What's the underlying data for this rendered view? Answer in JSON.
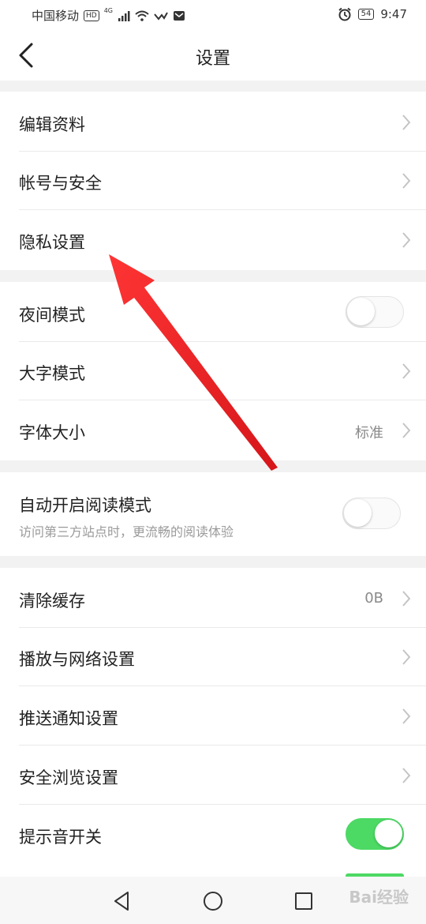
{
  "status_bar": {
    "carrier": "中国移动",
    "hd": "HD",
    "network": "4G",
    "battery": "54",
    "time": "9:47"
  },
  "header": {
    "title": "设置"
  },
  "groups": {
    "account": [
      {
        "label": "编辑资料"
      },
      {
        "label": "帐号与安全"
      },
      {
        "label": "隐私设置"
      }
    ],
    "display": [
      {
        "label": "夜间模式",
        "toggle": false
      },
      {
        "label": "大字模式"
      },
      {
        "label": "字体大小",
        "value": "标准"
      }
    ],
    "reading": {
      "label": "自动开启阅读模式",
      "description": "访问第三方站点时，更流畅的阅读体验",
      "toggle": false
    },
    "other": [
      {
        "label": "清除缓存",
        "value": "0B"
      },
      {
        "label": "播放与网络设置"
      },
      {
        "label": "推送通知设置"
      },
      {
        "label": "安全浏览设置"
      },
      {
        "label": "提示音开关",
        "toggle": true
      }
    ]
  },
  "colors": {
    "toggle_on": "#4cd964",
    "annotation_arrow": "#e8161a"
  },
  "icons": [
    "back-icon",
    "chevron-right-icon",
    "nav-back-icon",
    "nav-home-icon",
    "nav-recent-icon",
    "alarm-icon",
    "wifi-icon",
    "signal-icon"
  ],
  "watermark": "Bai经验"
}
